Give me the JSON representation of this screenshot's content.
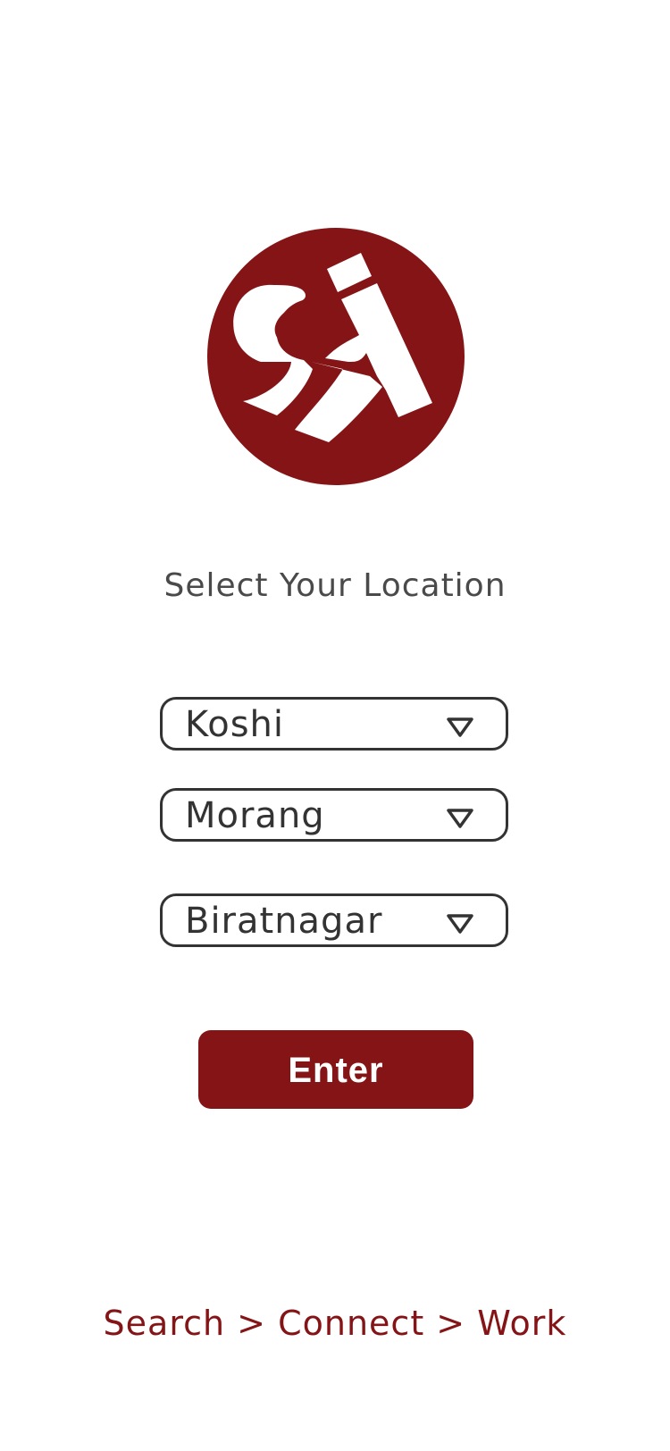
{
  "brand": {
    "logo_icon": "brand-logo-icon",
    "color": "#841416"
  },
  "heading": "Select Your Location",
  "location": {
    "province": "Koshi",
    "district": "Morang",
    "city": "Biratnagar",
    "dropdown_icon": "triangle-down-icon"
  },
  "enter_button": "Enter",
  "tagline": "Search > Connect > Work"
}
